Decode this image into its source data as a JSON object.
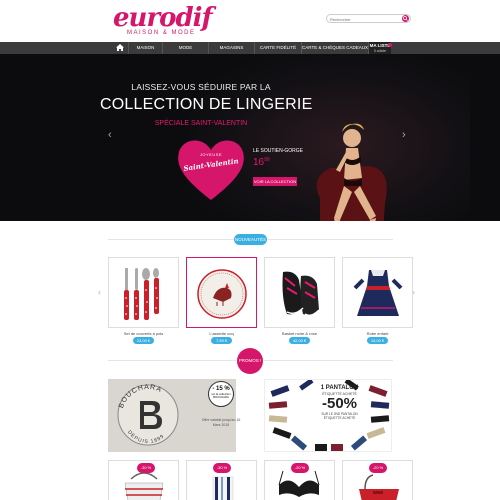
{
  "brand": {
    "logo": "eurodif",
    "tagline": "MAISON & MODE",
    "color": "#d6166b"
  },
  "search": {
    "placeholder": "Rechercher"
  },
  "nav": {
    "items": [
      "MAISON",
      "MODE",
      "MAGASINS",
      "CARTE FIDÉLITÉ",
      "CARTE & CHÈQUES CADEAUX"
    ],
    "list_title": "MA LISTE",
    "list_sub": "0 article"
  },
  "hero": {
    "line1": "LAISSEZ-VOUS SÉDUIRE PAR LA",
    "line2": "COLLECTION DE LINGERIE",
    "line3": "SPÉCIALE SAINT-VALENTIN",
    "heart_small": "JOYEUSE",
    "heart_script": "Saint-Valentin",
    "product_label": "LE SOUTIEN-GORGE",
    "price": "16",
    "price_cents": "99",
    "button": "VOIR LA COLLECTION"
  },
  "sections": {
    "new": "NOUVEAUTÉS",
    "promo": "PROMOS !"
  },
  "products": [
    {
      "name": "Set de couverts à pois",
      "price": "23,00 €"
    },
    {
      "name": "L'assiette coq",
      "price": "7,99 €"
    },
    {
      "name": "Basket noire & rose",
      "price": "42,00 €"
    },
    {
      "name": "Robe enfant",
      "price": "19,00 €"
    }
  ],
  "promo_left": {
    "discount": "- 15 %",
    "discount_sub": "sur la collection BOUCHARA",
    "brand": "BOUCHARA",
    "offer": "Offre valable jusqu'au 16 Mars 2015"
  },
  "promo_right": {
    "line1": "1 PANTALON",
    "line2": "ÉTIQUETTE ACHETÉ",
    "discount": "-50%",
    "line3": "SUR LE 2ND PANTALON",
    "line4": "ÉTIQUETTE ACHETÉ"
  },
  "bottom_badges": [
    "-30 %",
    "-30 %",
    "-20 %",
    "-20 %"
  ],
  "colors": {
    "pink": "#d6166b",
    "blue": "#3ab0e2",
    "nav": "#3b3b3b"
  }
}
